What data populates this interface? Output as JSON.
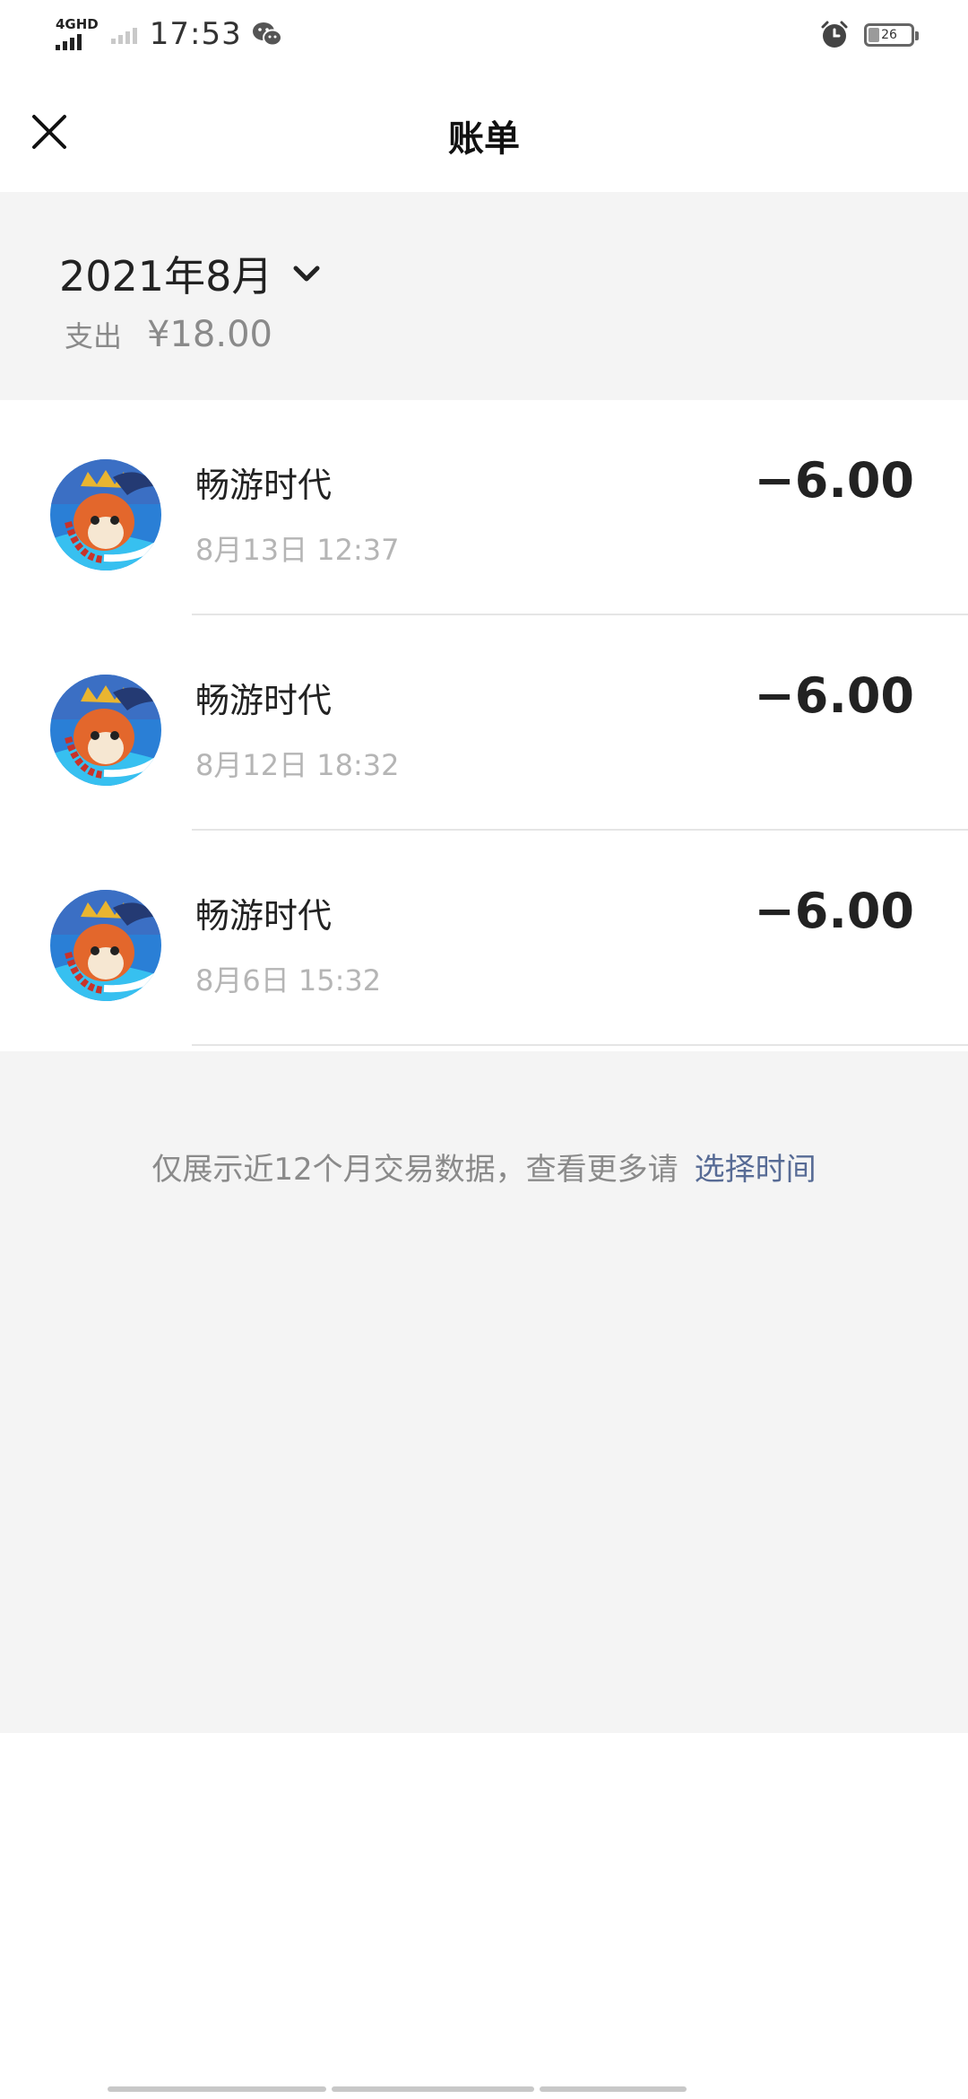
{
  "status_bar": {
    "network": "4GHD",
    "time": "17:53",
    "battery": "26"
  },
  "header": {
    "title": "账单"
  },
  "summary": {
    "month": "2021年8月",
    "spend_label": "支出",
    "spend_amount": "¥18.00"
  },
  "transactions": [
    {
      "merchant": "畅游时代",
      "time": "8月13日  12:37",
      "amount": "−6.00"
    },
    {
      "merchant": "畅游时代",
      "time": "8月12日  18:32",
      "amount": "−6.00"
    },
    {
      "merchant": "畅游时代",
      "time": "8月6日  15:32",
      "amount": "−6.00"
    }
  ],
  "footer": {
    "note": "仅展示近12个月交易数据，查看更多请",
    "link": "选择时间"
  },
  "colors": {
    "link": "#576b95",
    "background_gray": "#f4f4f4"
  }
}
